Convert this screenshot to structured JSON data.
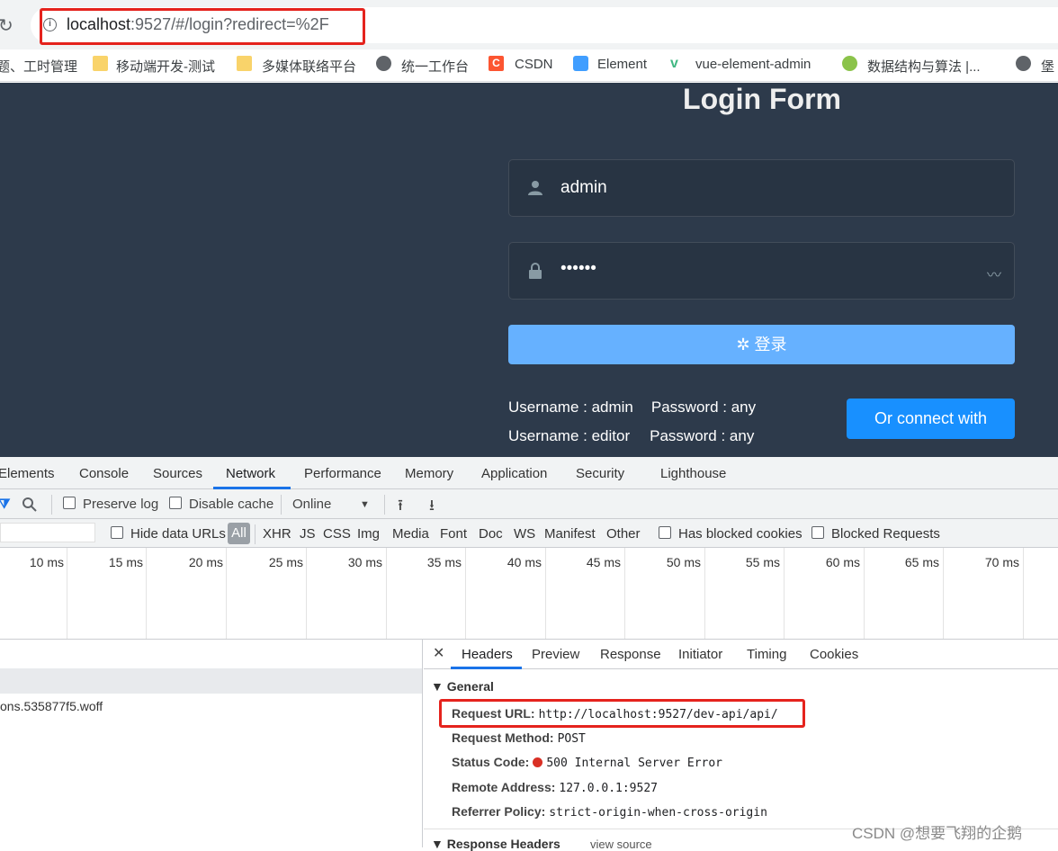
{
  "address_bar": {
    "url_host": "localhost",
    "url_rest": ":9527/#/login?redirect=%2F"
  },
  "bookmarks": [
    {
      "label": "题、工时管理",
      "icon": "folder-icon"
    },
    {
      "label": "移动端开发-测试",
      "icon": "folder-icon"
    },
    {
      "label": "多媒体联络平台",
      "icon": "folder-icon"
    },
    {
      "label": "统一工作台",
      "icon": "globe-icon"
    },
    {
      "label": "CSDN",
      "icon": "csdn-icon"
    },
    {
      "label": "Element",
      "icon": "element-icon"
    },
    {
      "label": "vue-element-admin",
      "icon": "vue-icon"
    },
    {
      "label": "数据结构与算法 |...",
      "icon": "site-icon"
    },
    {
      "label": "堡",
      "icon": "globe-icon"
    }
  ],
  "login": {
    "title": "Login Form",
    "username_value": "admin",
    "password_value": "••••••",
    "login_button": "登录",
    "tips": [
      {
        "user": "Username : admin",
        "pass": "Password : any"
      },
      {
        "user": "Username : editor",
        "pass": "Password : any"
      }
    ],
    "connect_button": "Or connect with"
  },
  "devtools": {
    "tabs": [
      "Elements",
      "Console",
      "Sources",
      "Network",
      "Performance",
      "Memory",
      "Application",
      "Security",
      "Lighthouse"
    ],
    "active_tab": "Network",
    "toolbar": {
      "preserve_log": "Preserve log",
      "disable_cache": "Disable cache",
      "throttle": "Online"
    },
    "filter": {
      "hide_data_urls": "Hide data URLs",
      "all": "All",
      "types": [
        "XHR",
        "JS",
        "CSS",
        "Img",
        "Media",
        "Font",
        "Doc",
        "WS",
        "Manifest",
        "Other"
      ],
      "has_blocked_cookies": "Has blocked cookies",
      "blocked_requests": "Blocked Requests"
    },
    "timeline_ticks": [
      "10 ms",
      "15 ms",
      "20 ms",
      "25 ms",
      "30 ms",
      "35 ms",
      "40 ms",
      "45 ms",
      "50 ms",
      "55 ms",
      "60 ms",
      "65 ms",
      "70 ms"
    ],
    "request_row": "ons.535877f5.woff",
    "detail_tabs": [
      "Headers",
      "Preview",
      "Response",
      "Initiator",
      "Timing",
      "Cookies"
    ],
    "general_title": "General",
    "general": {
      "request_url_k": "Request URL:",
      "request_url_v": "http://localhost:9527/dev-api/api/",
      "method_k": "Request Method:",
      "method_v": "POST",
      "status_k": "Status Code:",
      "status_v": "500 Internal Server Error",
      "remote_k": "Remote Address:",
      "remote_v": "127.0.0.1:9527",
      "referrer_k": "Referrer Policy:",
      "referrer_v": "strict-origin-when-cross-origin"
    },
    "response_headers_title": "Response Headers",
    "view_source": "view source"
  },
  "watermark": "CSDN @想要飞翔的企鹅",
  "colors": {
    "login_bg": "#2d3a4b",
    "login_button": "#66b1ff",
    "connect_button": "#1890ff",
    "highlight_box": "#e5231d",
    "status_error": "#d93025"
  }
}
